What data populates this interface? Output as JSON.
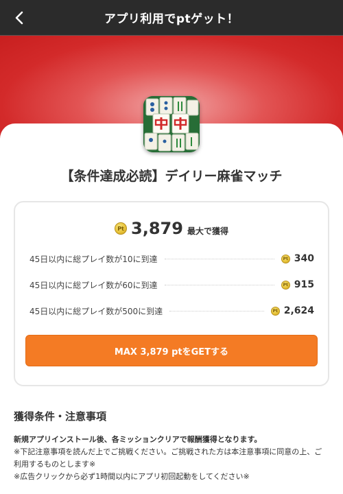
{
  "header": {
    "title": "アプリ利用でptゲット！",
    "back_icon": "chevron-left-icon"
  },
  "app": {
    "title": "【条件達成必読】デイリー麻雀マッチ",
    "icon": "mahjong-app-icon"
  },
  "reward": {
    "coin_label": "Pt",
    "total": "3,879",
    "total_suffix": "最大で獲得",
    "conditions": [
      {
        "label": "45日以内に総プレイ数が10に到達",
        "points": "340"
      },
      {
        "label": "45日以内に総プレイ数が60に到達",
        "points": "915"
      },
      {
        "label": "45日以内に総プレイ数が500に到達",
        "points": "2,624"
      }
    ],
    "button_label": "MAX 3,879 ptをGETする"
  },
  "notes": {
    "title": "獲得条件・注意事項",
    "lines": [
      "新規アプリインストール後、各ミッションクリアで報酬獲得となります。",
      "※下記注意事項を読んだ上でご挑戦ください。ご挑戦された方は本注意事項に同意の上、ご利用するものとします※",
      "※広告クリックから必ず1時間以内にアプリ初回起動をしてください※"
    ]
  },
  "colors": {
    "header": "#2b2b2b",
    "hero": "#d32a2a",
    "button": "#f47b24",
    "coin": "#e8c43a"
  }
}
